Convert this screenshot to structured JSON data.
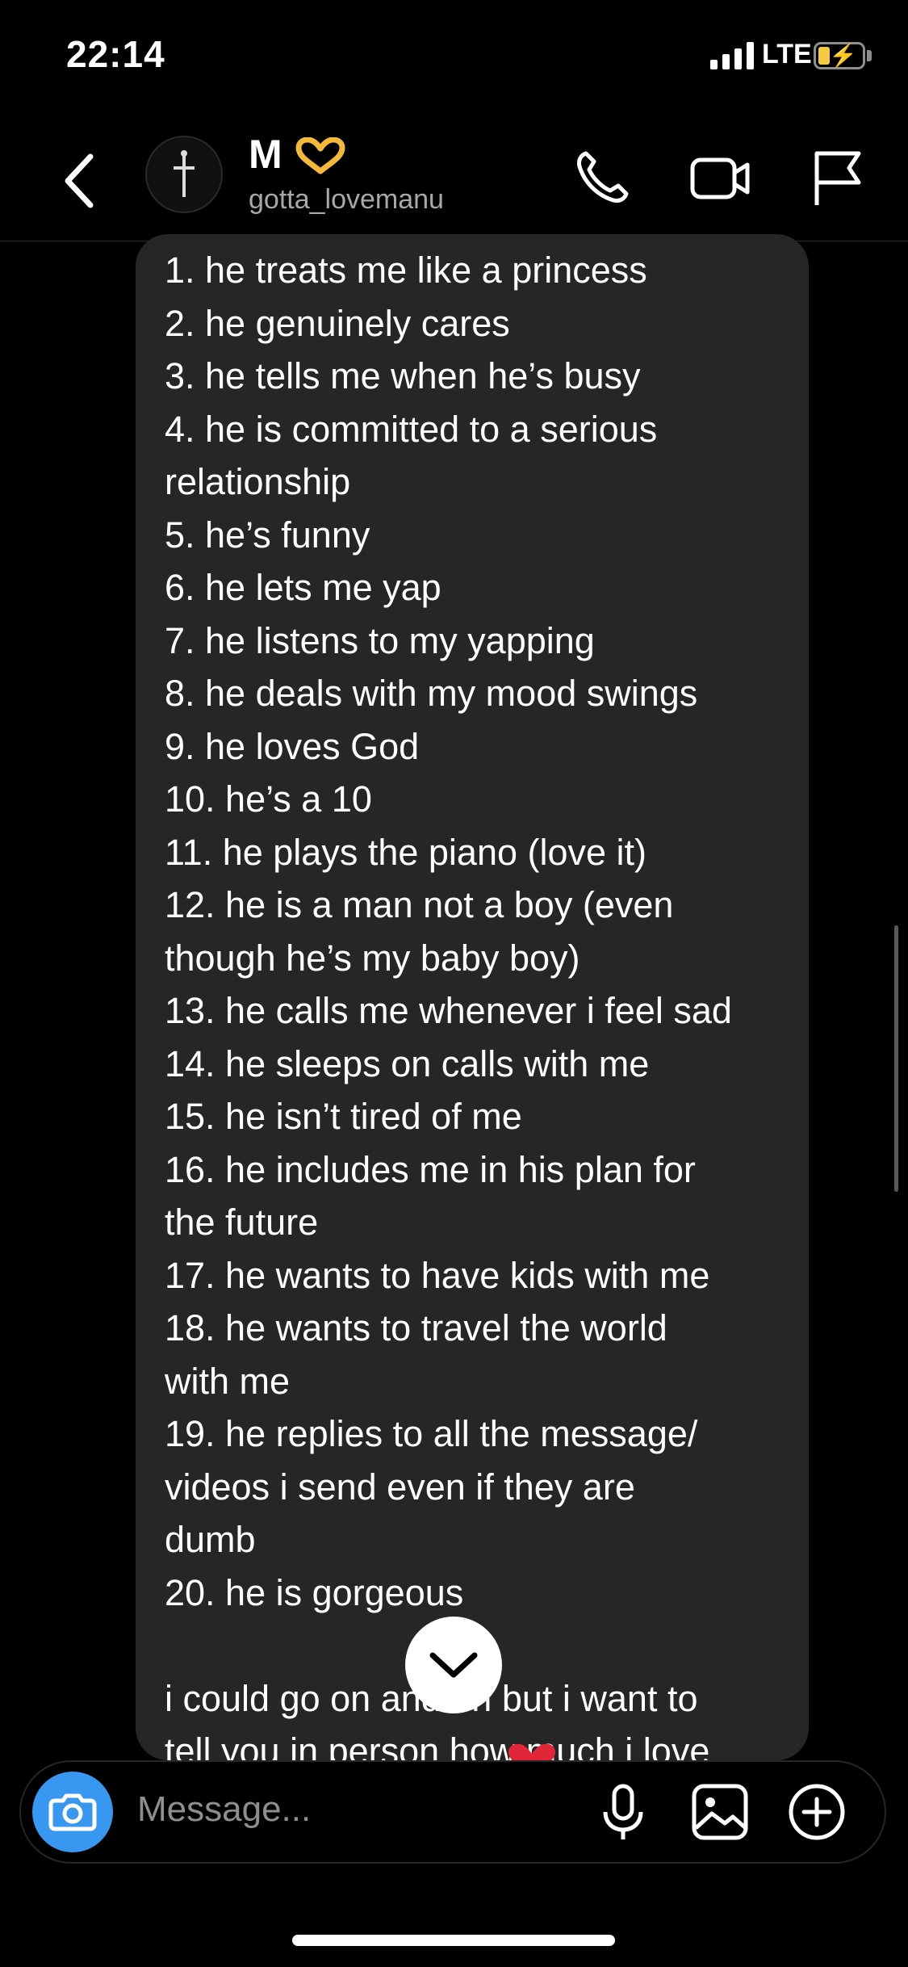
{
  "status_bar": {
    "time": "22:14",
    "network": "LTE"
  },
  "header": {
    "name": "M",
    "username": "gotta_lovemanu"
  },
  "icons": {
    "back": "chevron-left-icon",
    "avatar": "cross-icon",
    "name_emoji": "heart-hands-icon",
    "call": "phone-icon",
    "video": "video-icon",
    "flag": "flag-icon",
    "camera": "camera-icon",
    "mic": "mic-icon",
    "gallery": "image-icon",
    "add": "plus-circle-icon",
    "scroll_down": "chevron-down-icon"
  },
  "message": {
    "lines": [
      "1. he treats me like a princess",
      "2. he genuinely cares",
      "3. he tells me when he’s busy",
      "4. he is committed to a serious",
      "relationship",
      "5. he’s funny",
      "6. he lets me yap",
      "7. he listens to my yapping",
      "8. he deals with my mood swings",
      "9. he loves God",
      "10. he’s a 10",
      "11. he plays the piano (love it)",
      "12. he is a man not a boy (even",
      "though he’s my baby boy)",
      "13. he calls me whenever i feel sad",
      "14. he sleeps on calls with me",
      "15. he isn’t tired of me",
      "16. he includes me in his plan for",
      "the future",
      "17. he wants to have kids with me",
      "18. he wants to travel the world",
      "with me",
      "19. he replies to all the message/",
      "videos i send even if they are",
      "dumb",
      "20. he is gorgeous",
      "",
      "i could go on and on but i want to",
      "tell you in person how much i love"
    ]
  },
  "composer": {
    "placeholder": "Message..."
  },
  "colors": {
    "background": "#000000",
    "bubble": "#262626",
    "accent": "#3897f0",
    "muted": "#a8a8a8",
    "battery": "#f6c945"
  }
}
